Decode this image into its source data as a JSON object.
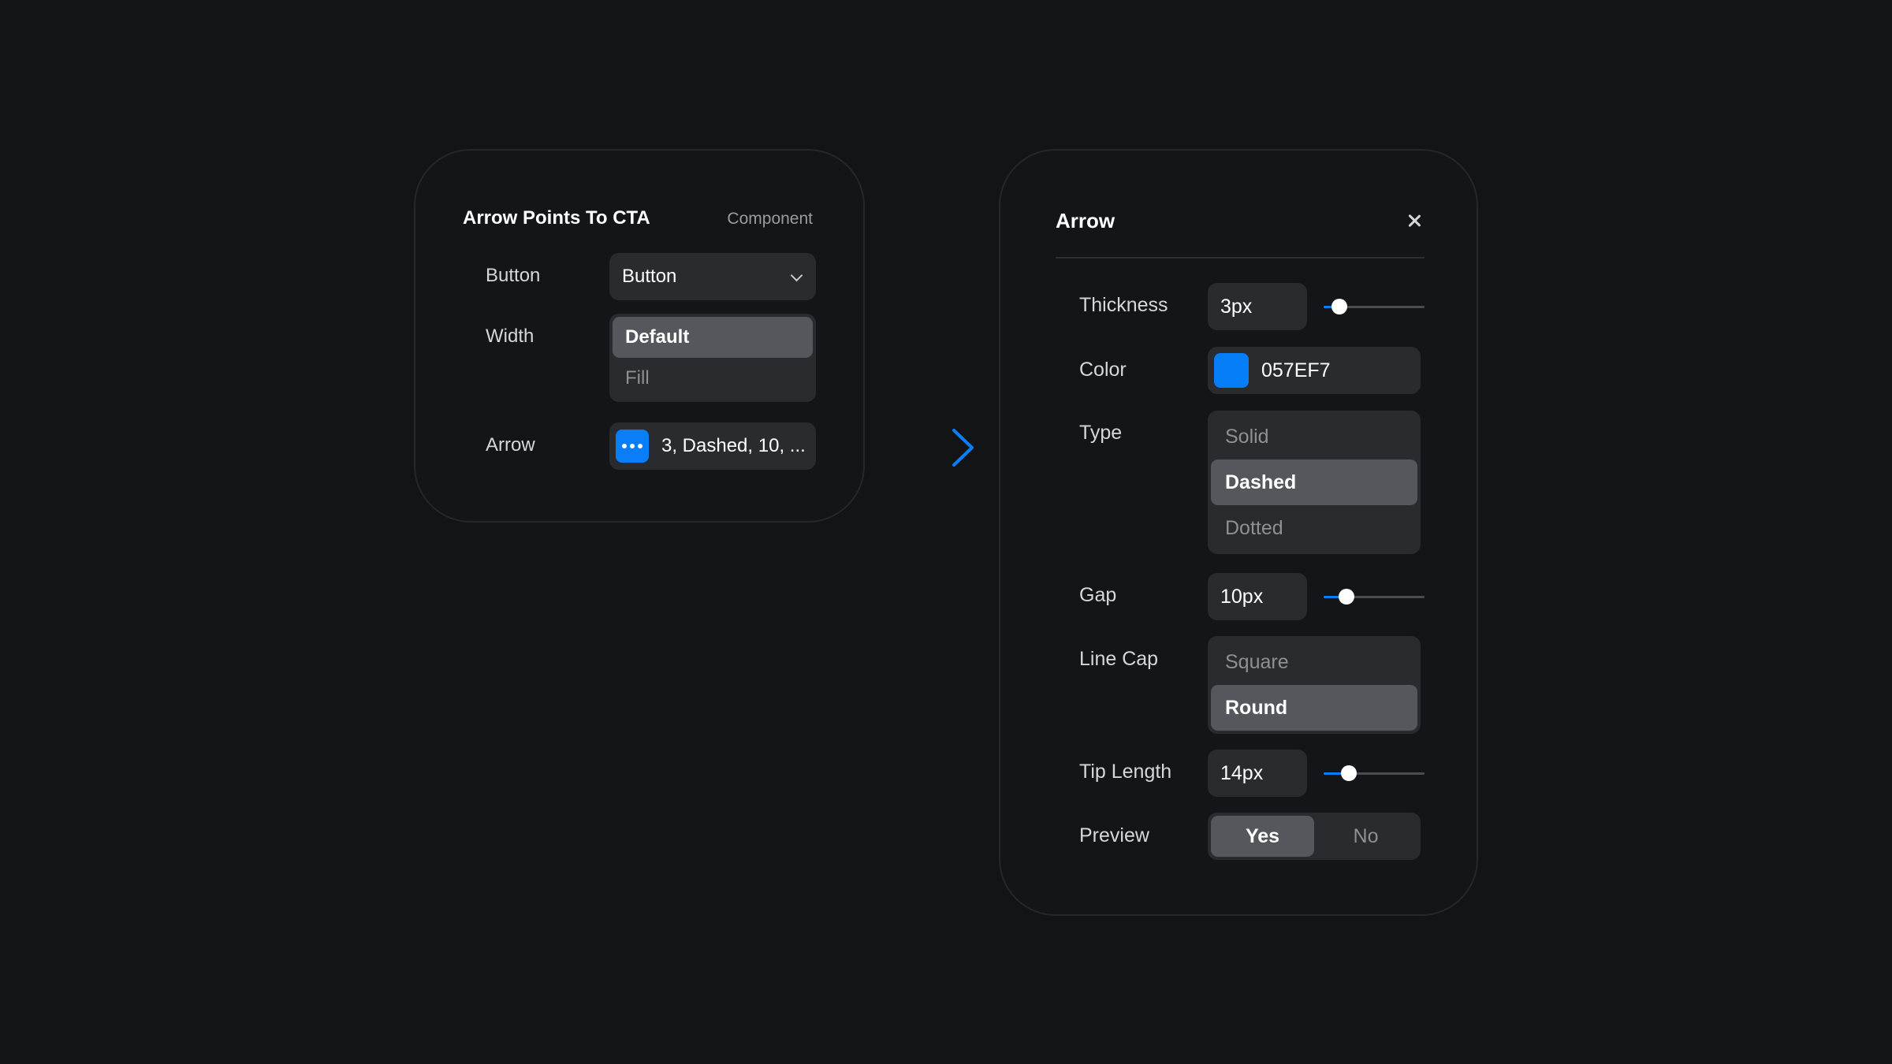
{
  "colors": {
    "background": "#131416",
    "card": "#141518",
    "control": "#2a2b2f",
    "selected": "#55575c",
    "accent": "#0a7ef7"
  },
  "component_card": {
    "title": "Arrow Points To CTA",
    "tag": "Component",
    "button": {
      "label": "Button",
      "value": "Button"
    },
    "width": {
      "label": "Width",
      "options": [
        "Default",
        "Fill"
      ],
      "selected": "Default"
    },
    "arrow": {
      "label": "Arrow",
      "button_icon": "more-dots-icon",
      "value": "3, Dashed, 10, ..."
    }
  },
  "connector": {
    "icon": "arrow-right-icon"
  },
  "arrow_panel": {
    "title": "Arrow",
    "close_icon": "close-icon",
    "thickness": {
      "label": "Thickness",
      "value": "3px",
      "slider_fraction": 0.16
    },
    "color": {
      "label": "Color",
      "value": "057EF7",
      "swatch": "#057EF7"
    },
    "type": {
      "label": "Type",
      "options": [
        "Solid",
        "Dashed",
        "Dotted"
      ],
      "selected": "Dashed"
    },
    "gap": {
      "label": "Gap",
      "value": "10px",
      "slider_fraction": 0.23
    },
    "line_cap": {
      "label": "Line Cap",
      "options": [
        "Square",
        "Round"
      ],
      "selected": "Round"
    },
    "tip_length": {
      "label": "Tip Length",
      "value": "14px",
      "slider_fraction": 0.25
    },
    "preview": {
      "label": "Preview",
      "options": [
        "Yes",
        "No"
      ],
      "selected": "Yes"
    }
  }
}
